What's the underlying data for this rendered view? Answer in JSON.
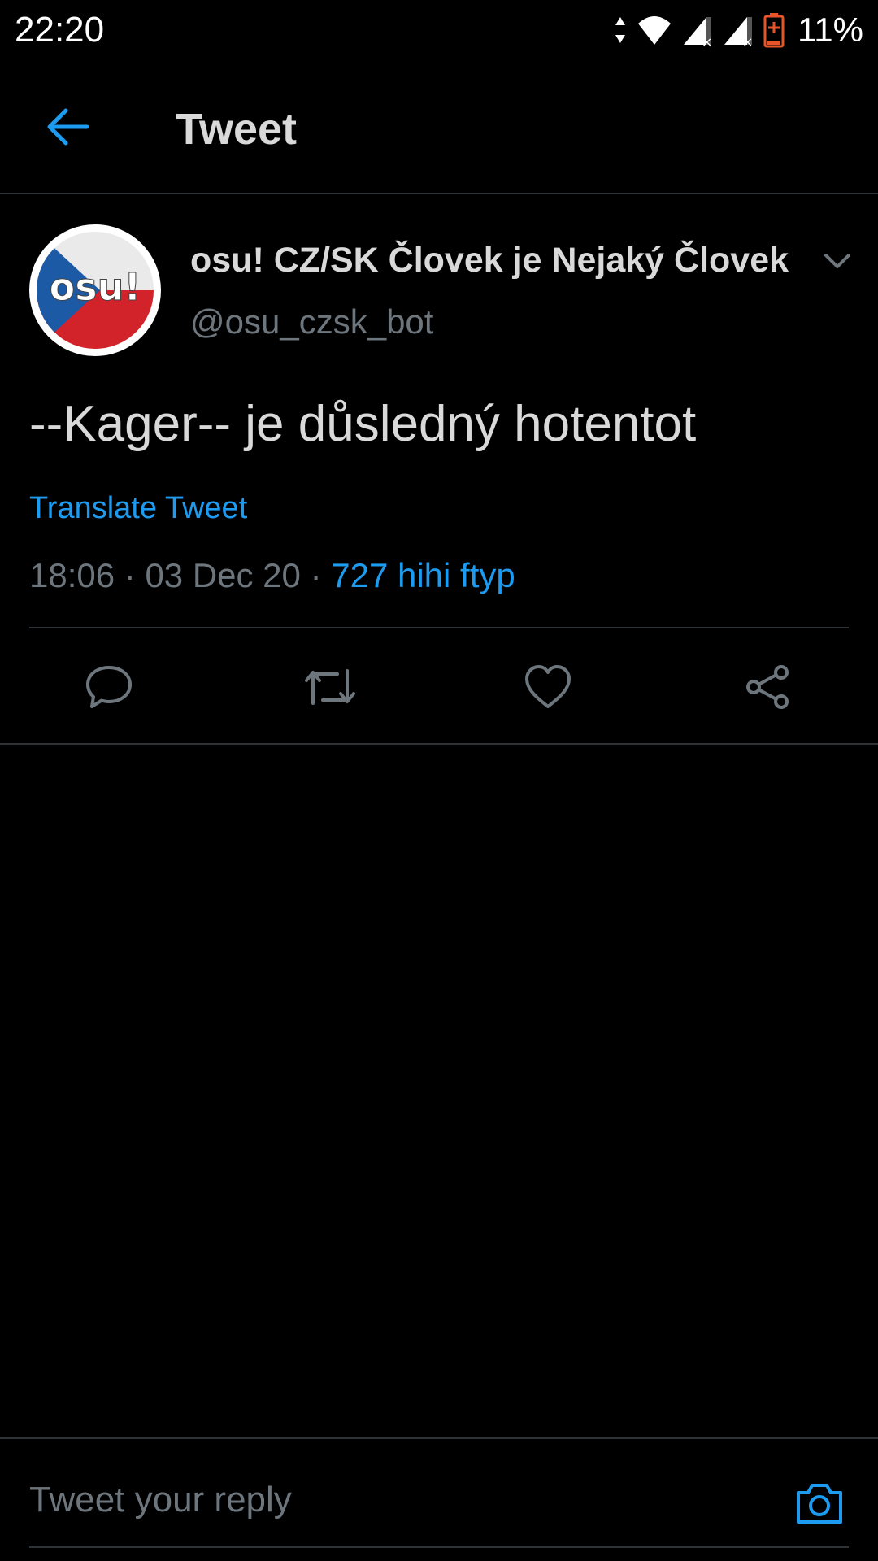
{
  "status_bar": {
    "time": "22:20",
    "battery_percent": "11%",
    "battery_level": 0.11,
    "icons": [
      "data-arrows-icon",
      "wifi-icon",
      "signal-x-icon",
      "signal-x-icon",
      "battery-charging-icon"
    ]
  },
  "app_bar": {
    "title": "Tweet",
    "back_icon": "arrow-left-icon"
  },
  "tweet": {
    "author_name": "osu! CZ/SK Človek je Nejaký Človek",
    "author_handle": "@osu_czsk_bot",
    "avatar_text": "osu!",
    "text": "--Kager-- je důsledný hotentot",
    "translate_label": "Translate Tweet",
    "time": "18:06",
    "separator": " · ",
    "date": "03 Dec 20",
    "source": "727 hihi ftyp"
  },
  "actions": [
    {
      "name": "reply",
      "icon": "reply-icon"
    },
    {
      "name": "retweet",
      "icon": "retweet-icon"
    },
    {
      "name": "like",
      "icon": "heart-icon"
    },
    {
      "name": "share",
      "icon": "share-icon"
    }
  ],
  "reply_bar": {
    "placeholder": "Tweet your reply",
    "camera_icon": "camera-icon"
  },
  "colors": {
    "background": "#000000",
    "text": "#d9d9d9",
    "secondary_text": "#6e767d",
    "accent": "#1d9bf0",
    "divider": "#2f3336",
    "battery_low": "#e8542a"
  }
}
